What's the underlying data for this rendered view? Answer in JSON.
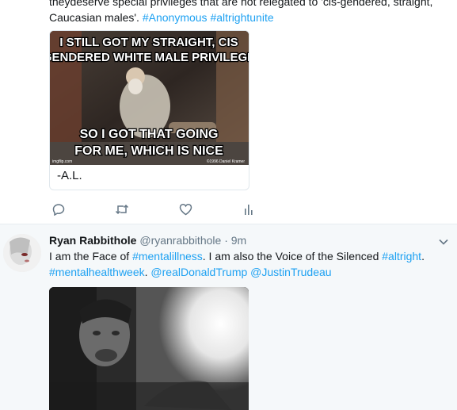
{
  "tweet1": {
    "text_line1": "theydeserve special privileges that are not relegated to 'cis-gendered, straight,",
    "text_line2_plain": "Caucasian males'. ",
    "hashtag1": "#Anonymous",
    "hashtag2": "#altrightunite",
    "meme": {
      "top_line1": "I STILL GOT MY STRAIGHT, CIS",
      "top_line2": "GENDERED WHITE MALE PRIVILEGE",
      "bottom_line1": "SO I GOT THAT GOING",
      "bottom_line2": "FOR ME, WHICH IS NICE",
      "watermark_left": "imgflip.com",
      "watermark_right": "©1996 Daniel Kramer"
    },
    "card_caption": "-A.L.",
    "actions": [
      "reply-icon",
      "retweet-icon",
      "like-icon",
      "analytics-icon"
    ]
  },
  "tweet2": {
    "name": "Ryan Rabbithole",
    "handle": "@ryanrabbithole",
    "dot": "·",
    "time": "9m",
    "text_plain1": "I am the Face of ",
    "hashtag1": "#mentalillness",
    "text_plain2": ". I am also the Voice of the Silenced ",
    "hashtag2": "#altright",
    "text_plain3": ".",
    "hashtag3": "#mentalhealthweek",
    "mention1": "@realDonaldTrump",
    "mention2": "@JustinTrudeau"
  },
  "colors": {
    "link": "#1da1f2",
    "muted": "#657786",
    "text": "#14171a",
    "highlight_bg": "#f5f8fa"
  }
}
